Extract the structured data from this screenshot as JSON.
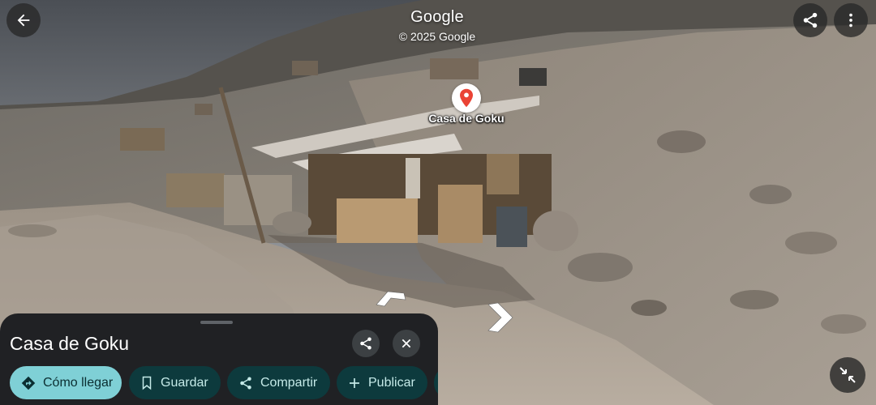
{
  "attribution": {
    "brand": "Google",
    "copyright": "© 2025 Google"
  },
  "place": {
    "pin_label": "Casa de Goku",
    "title": "Casa de Goku"
  },
  "actions": [
    {
      "label": "Cómo llegar",
      "icon": "directions-icon"
    },
    {
      "label": "Guardar",
      "icon": "bookmark-icon"
    },
    {
      "label": "Compartir",
      "icon": "share-icon"
    },
    {
      "label": "Publicar",
      "icon": "plus-icon"
    }
  ],
  "colors": {
    "pin": "#ea4335",
    "sheet_background": "#202124",
    "primary_chip": "#7fd0d6",
    "secondary_chip": "#0d3a3d"
  }
}
